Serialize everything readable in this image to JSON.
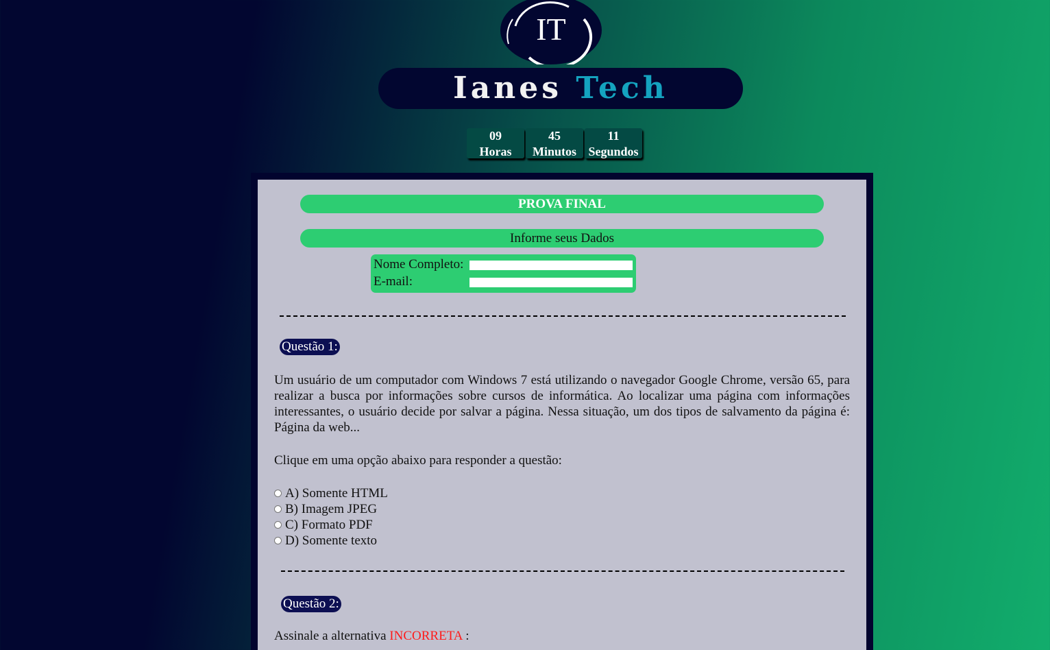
{
  "logo": {
    "initials": "IT",
    "name_part1": "Ianes",
    "name_part2": "Tech"
  },
  "timer": {
    "hours": "09",
    "hours_label": "Horas",
    "minutes": "45",
    "minutes_label": "Minutos",
    "seconds": "11",
    "seconds_label": "Segundos"
  },
  "exam": {
    "title": "PROVA FINAL",
    "form_heading": "Informe seus Dados",
    "name_label": "Nome Completo:",
    "name_value": "",
    "email_label": "E-mail:",
    "email_value": ""
  },
  "questions": [
    {
      "badge": "Questão 1:",
      "text": "Um usuário de um computador com Windows 7 está utilizando o navegador Google Chrome, versão 65, para realizar a busca por informações sobre cursos de informática. Ao localizar uma página com informações interessantes, o usuário decide por salvar a página. Nessa situação, um dos tipos de salvamento da página é: Página da web...",
      "instruction": "Clique em uma opção abaixo para responder a questão:",
      "options": [
        "A) Somente HTML",
        "B) Imagem JPEG",
        "C) Formato PDF",
        "D) Somente texto"
      ]
    },
    {
      "badge": "Questão 2:",
      "prompt_before": "Assinale a alternativa",
      "prompt_highlight": "INCORRETA",
      "prompt_after": ":"
    }
  ],
  "colors": {
    "green_bar": "#2dcd72",
    "badge_bg": "#0c0f52",
    "panel_bg": "#c1c1cf",
    "highlight_red": "#ff1a1a",
    "brand_cyan": "#14a3bf"
  }
}
